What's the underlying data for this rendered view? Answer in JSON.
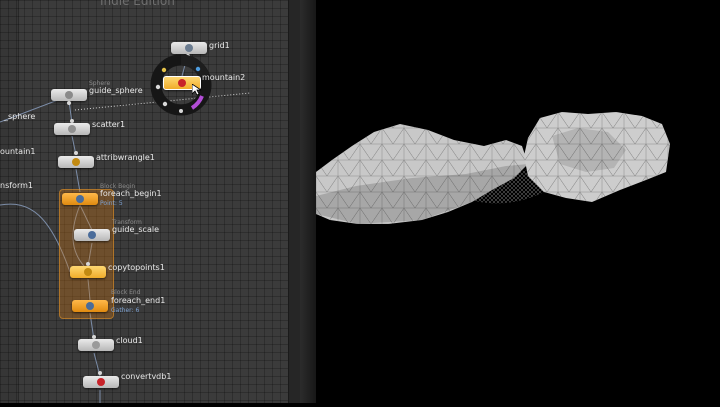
{
  "network": {
    "header": "Indie Edition",
    "left_labels": {
      "sphere": "_sphere",
      "mountain": "ountain1",
      "transform": "nsform1"
    },
    "nodes": {
      "grid1": {
        "label": "grid1"
      },
      "mountain2": {
        "label": "mountain2"
      },
      "guide_sphere": {
        "label": "guide_sphere",
        "type": "Sphere"
      },
      "scatter1": {
        "label": "scatter1"
      },
      "attribwrangle1": {
        "label": "attribwrangle1"
      },
      "foreach_begin1": {
        "label": "foreach_begin1",
        "type": "Block Begin",
        "attr": "Point: 5"
      },
      "guide_scale": {
        "label": "guide_scale",
        "type": "Transform"
      },
      "copytopoints1": {
        "label": "copytopoints1"
      },
      "foreach_end1": {
        "label": "foreach_end1",
        "type": "Block End",
        "attr": "Gather: 6"
      },
      "cloud1": {
        "label": "cloud1"
      },
      "convertvdb1": {
        "label": "convertvdb1"
      }
    }
  },
  "colors": {
    "network_bg": "#3b3b3b",
    "node_gray": "#d0d0d0",
    "node_orange": "#f0a030",
    "loop_block": "#d27814",
    "wire": "#7c8da8",
    "viewport_bg": "#000000",
    "rock": "#c6c6c6"
  }
}
